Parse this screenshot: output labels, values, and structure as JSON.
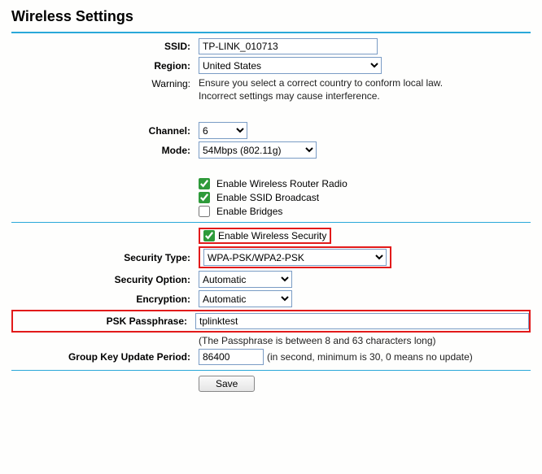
{
  "page_title": "Wireless Settings",
  "labels": {
    "ssid": "SSID:",
    "region": "Region:",
    "warning": "Warning:",
    "channel": "Channel:",
    "mode": "Mode:",
    "security_type": "Security Type:",
    "security_option": "Security Option:",
    "encryption": "Encryption:",
    "psk": "PSK Passphrase:",
    "group_key": "Group Key Update Period:"
  },
  "warning_line1": "Ensure you select a correct country to conform local law.",
  "warning_line2": "Incorrect settings may cause interference.",
  "fields": {
    "ssid": "TP-LINK_010713",
    "region": "United States",
    "channel": "6",
    "mode": "54Mbps (802.11g)",
    "security_type": "WPA-PSK/WPA2-PSK",
    "security_option": "Automatic",
    "encryption": "Automatic",
    "psk": "tplinktest",
    "group_key": "86400"
  },
  "checkboxes": {
    "router_radio": "Enable Wireless Router Radio",
    "ssid_broadcast": "Enable SSID Broadcast",
    "bridges": "Enable Bridges",
    "security": "Enable Wireless Security"
  },
  "notes": {
    "psk": "(The Passphrase is between 8 and 63 characters long)",
    "group_key": "(in second, minimum is 30, 0 means no update)"
  },
  "save_label": "Save"
}
